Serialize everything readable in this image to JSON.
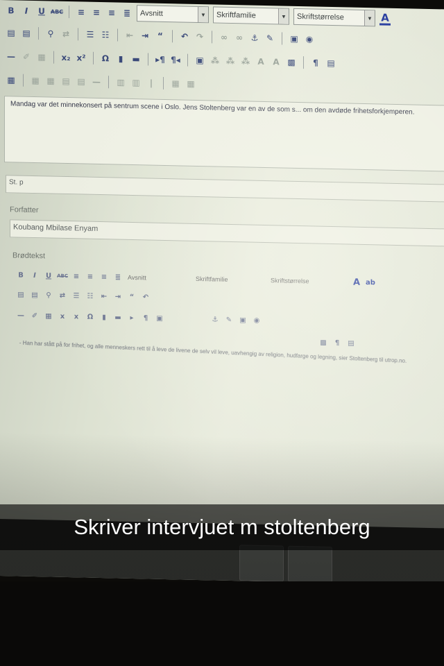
{
  "editor": {
    "toolbar": {
      "paragraph_select": "Avsnitt",
      "font_family_select": "Skriftfamilie",
      "font_size_select": "Skriftstørrelse"
    },
    "content_text": "Mandag var det minnekonsert på sentrum scene i Oslo. Jens Stoltenberg var en av de som s... om den avdøde frihetsforkjemperen.",
    "short_field_value": "St. p",
    "author_label": "Forfatter",
    "author_value": "Koubang Mbilase Enyam",
    "body_label": "Brødtekst",
    "body_toolbar": {
      "paragraph_select": "Avsnitt",
      "font_family_select": "Skriftfamilie",
      "font_size_select": "Skriftstørrelse"
    },
    "body_text": "- Han har stått på for frihet, og alle menneskers rett til å leve de livene de selv vil leve, uavhengig av religion, hudfarge og legning, sier Stoltenberg til utrop.no."
  },
  "caption": "Skriver intervjuet m stoltenberg",
  "colors": {
    "screen_bg": "#e2e6d8",
    "caption_bg": "#000000",
    "caption_text": "#ffffff"
  }
}
